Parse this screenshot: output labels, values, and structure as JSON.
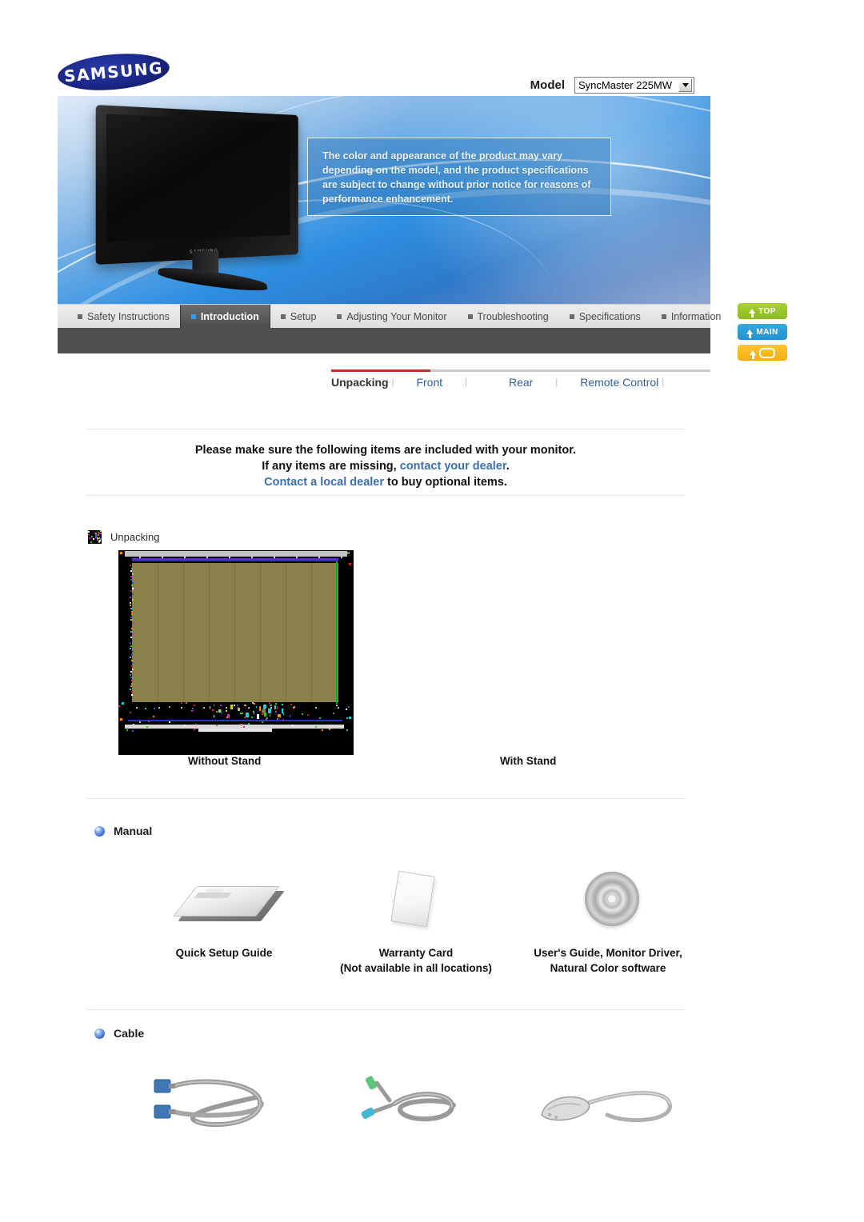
{
  "header": {
    "logo_text": "SAMSUNG",
    "logo_icon": "samsung-logo",
    "model_label": "Model",
    "model_value": "SyncMaster 225MW",
    "model_arrow_icon": "chevron-down-icon"
  },
  "banner": {
    "disclaimer": "The color and appearance of the product may vary depending on the model, and the product specifications are subject to change without prior notice for reasons of performance enhancement.",
    "monitor_brand": "SAMSUNG",
    "monitor_image_name": "lcd-monitor-photo"
  },
  "main_nav": [
    {
      "label": "Safety Instructions",
      "active": false
    },
    {
      "label": "Introduction",
      "active": true
    },
    {
      "label": "Setup",
      "active": false
    },
    {
      "label": "Adjusting Your Monitor",
      "active": false
    },
    {
      "label": "Troubleshooting",
      "active": false
    },
    {
      "label": "Specifications",
      "active": false
    },
    {
      "label": "Information",
      "active": false
    }
  ],
  "side_buttons": [
    {
      "label": "TOP",
      "icon": "up-arrow-icon",
      "color": "#8cbb22"
    },
    {
      "label": "MAIN",
      "icon": "main-arrow-icon",
      "color": "#1f92d0"
    },
    {
      "label": "",
      "icon": "up-arrow-mail-icon",
      "color": "#f5ad11"
    }
  ],
  "sub_nav": [
    {
      "label": "Unpacking",
      "active": true
    },
    {
      "label": "Front",
      "active": false
    },
    {
      "label": "Rear",
      "active": false
    },
    {
      "label": "Remote Control",
      "active": false
    }
  ],
  "intro": {
    "line1": "Please make sure the following items are included with your monitor.",
    "line2_a": "If any items are missing, ",
    "line2_link": "contact your dealer",
    "line2_b": ".",
    "line3_link": "Contact a local dealer",
    "line3_b": " to buy optional items."
  },
  "unpacking": {
    "section_label": "Unpacking",
    "bullet_icon": "broken-image-icon",
    "image_name": "unpacking-broken-image",
    "label_without_stand": "Without Stand",
    "label_with_stand": "With Stand"
  },
  "manual": {
    "section_label": "Manual",
    "bullet_icon": "blue-sphere-bullet-icon",
    "items": [
      {
        "caption": "Quick Setup Guide",
        "art": "booklet-icon"
      },
      {
        "caption": "Warranty Card\n(Not available in all locations)",
        "art": "card-icon"
      },
      {
        "caption": "User's Guide, Monitor Driver,\nNatural Color software",
        "art": "cd-icon"
      }
    ]
  },
  "cable": {
    "section_label": "Cable",
    "bullet_icon": "blue-sphere-bullet-icon",
    "items": [
      {
        "caption": "",
        "art": "d-sub-cable-icon"
      },
      {
        "caption": "",
        "art": "audio-cable-icon"
      },
      {
        "caption": "",
        "art": "power-cord-icon"
      }
    ]
  },
  "colors": {
    "accent_blue": "#3b6fb5",
    "nav_active_bg": "#4c4c4c",
    "subnav_red": "#c0302b",
    "broken_panel": "#8a8049"
  }
}
